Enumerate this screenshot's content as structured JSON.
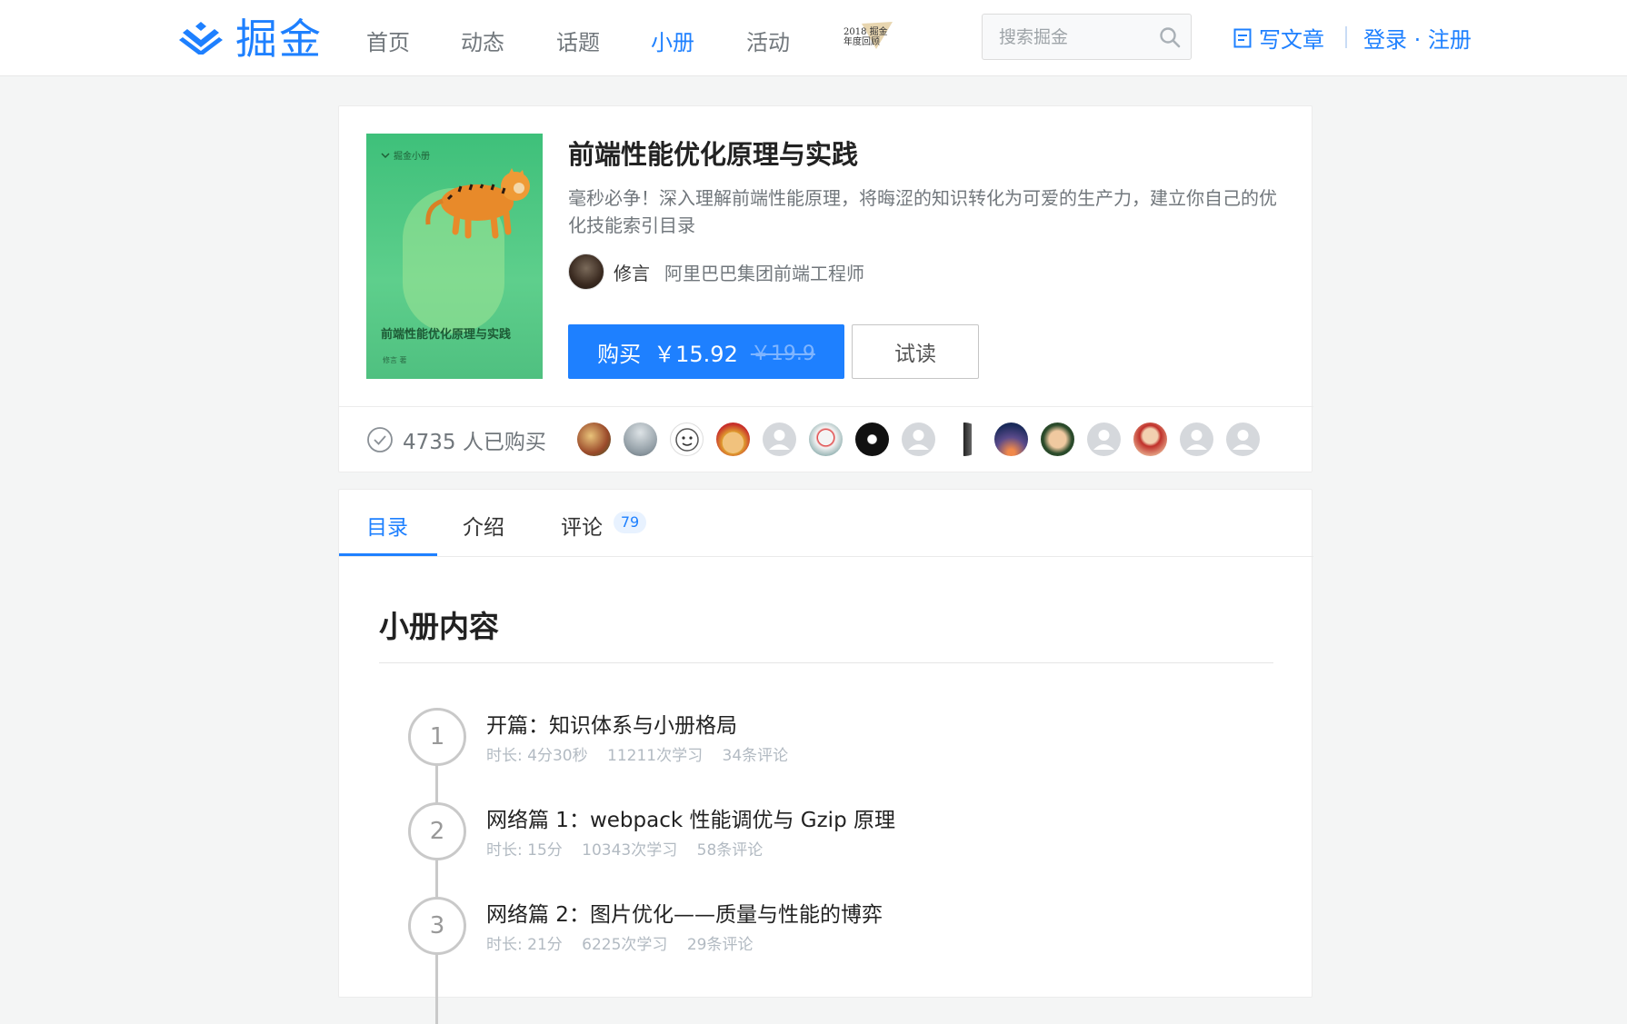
{
  "header": {
    "logo_text": "掘金",
    "nav": [
      {
        "label": "首页",
        "active": false
      },
      {
        "label": "动态",
        "active": false
      },
      {
        "label": "话题",
        "active": false
      },
      {
        "label": "小册",
        "active": true
      },
      {
        "label": "活动",
        "active": false
      }
    ],
    "badge_text": "2018 掘金年度回顾",
    "search_placeholder": "搜索掘金",
    "write_label": "写文章",
    "login_label": "登录 · 注册"
  },
  "book": {
    "cover_brand": "掘金小册",
    "cover_title": "前端性能优化原理与实践",
    "cover_author": "修言 著",
    "title": "前端性能优化原理与实践",
    "description": "毫秒必争！深入理解前端性能原理，将晦涩的知识转化为可爱的生产力，建立你自己的优化技能索引目录",
    "author_name": "修言",
    "author_title": "阿里巴巴集团前端工程师",
    "buy_label": "购买",
    "price": "￥15.92",
    "original_price": "￥19.9",
    "try_label": "试读",
    "bought_count_label": "4735 人已购买"
  },
  "tabs": [
    {
      "label": "目录",
      "active": true
    },
    {
      "label": "介绍",
      "active": false
    },
    {
      "label": "评论",
      "active": false
    }
  ],
  "comment_count": "79",
  "section_title": "小册内容",
  "chapters": [
    {
      "num": "1",
      "title": "开篇：知识体系与小册格局",
      "duration": "时长: 4分30秒",
      "learners": "11211次学习",
      "comments": "34条评论"
    },
    {
      "num": "2",
      "title": "网络篇 1：webpack 性能调优与 Gzip 原理",
      "duration": "时长: 15分",
      "learners": "10343次学习",
      "comments": "58条评论"
    },
    {
      "num": "3",
      "title": "网络篇 2：图片优化——质量与性能的博弈",
      "duration": "时长: 21分",
      "learners": "6225次学习",
      "comments": "29条评论"
    }
  ],
  "colors": {
    "accent": "#1e80ff",
    "muted": "#71777c",
    "meta": "#b2bac2"
  }
}
